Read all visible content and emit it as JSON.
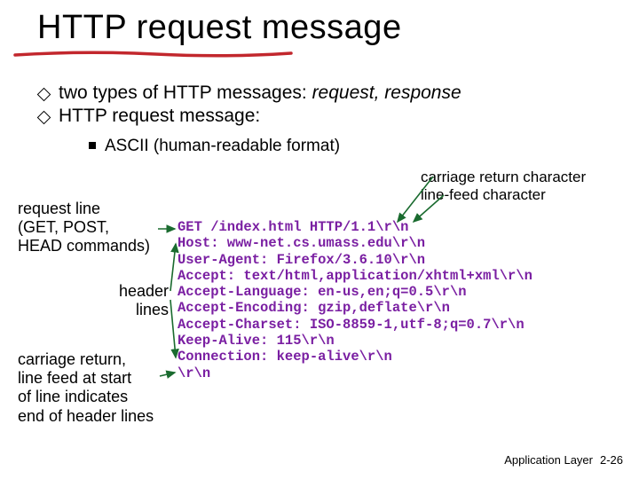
{
  "title": "HTTP request message",
  "bullets": {
    "b1_pre": "two types of HTTP messages: ",
    "b1_em": "request, response",
    "b2": "HTTP request message:",
    "sub": "ASCII (human-readable format)"
  },
  "annotations": {
    "crlf": "carriage return character\nline-feed character",
    "request_line": "request line\n(GET, POST,\nHEAD commands)",
    "header_lines": "header\nlines",
    "end_of_headers": "carriage return,\nline feed at start\nof line indicates\nend of header lines"
  },
  "code_lines": [
    "GET /index.html HTTP/1.1\\r\\n",
    "Host: www-net.cs.umass.edu\\r\\n",
    "User-Agent: Firefox/3.6.10\\r\\n",
    "Accept: text/html,application/xhtml+xml\\r\\n",
    "Accept-Language: en-us,en;q=0.5\\r\\n",
    "Accept-Encoding: gzip,deflate\\r\\n",
    "Accept-Charset: ISO-8859-1,utf-8;q=0.7\\r\\n",
    "Keep-Alive: 115\\r\\n",
    "Connection: keep-alive\\r\\n",
    "\\r\\n"
  ],
  "footer": {
    "label": "Application Layer",
    "page": "2-26"
  }
}
